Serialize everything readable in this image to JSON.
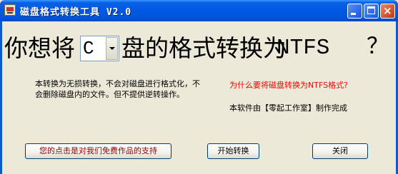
{
  "window": {
    "title": "磁盘格式转换工具 V2.0",
    "controls": {
      "minimize": "_",
      "maximize": "□",
      "close": "×"
    }
  },
  "main": {
    "headline_left": "你想将",
    "drive_value": "C",
    "headline_right": "盘的格式转换为",
    "headline_ntfs": "NTFS",
    "headline_question": "？",
    "description": "本转换为无损转换，不会对磁盘进行格式化，不会删除磁盘内的文件。但不提供逆转操作。",
    "why_link": "为什么要将磁盘转换为NTFS格式?",
    "credit": "本软件由【零起工作室】制作完成"
  },
  "buttons": {
    "support": "您的点击是对我们免费作品的支持",
    "start": "开始转换",
    "close": "关闭"
  },
  "colors": {
    "titlebar": "#0058e3",
    "dialog_bg": "#ece9d8",
    "link_red": "#ff0000",
    "support_text": "#8b0000"
  }
}
